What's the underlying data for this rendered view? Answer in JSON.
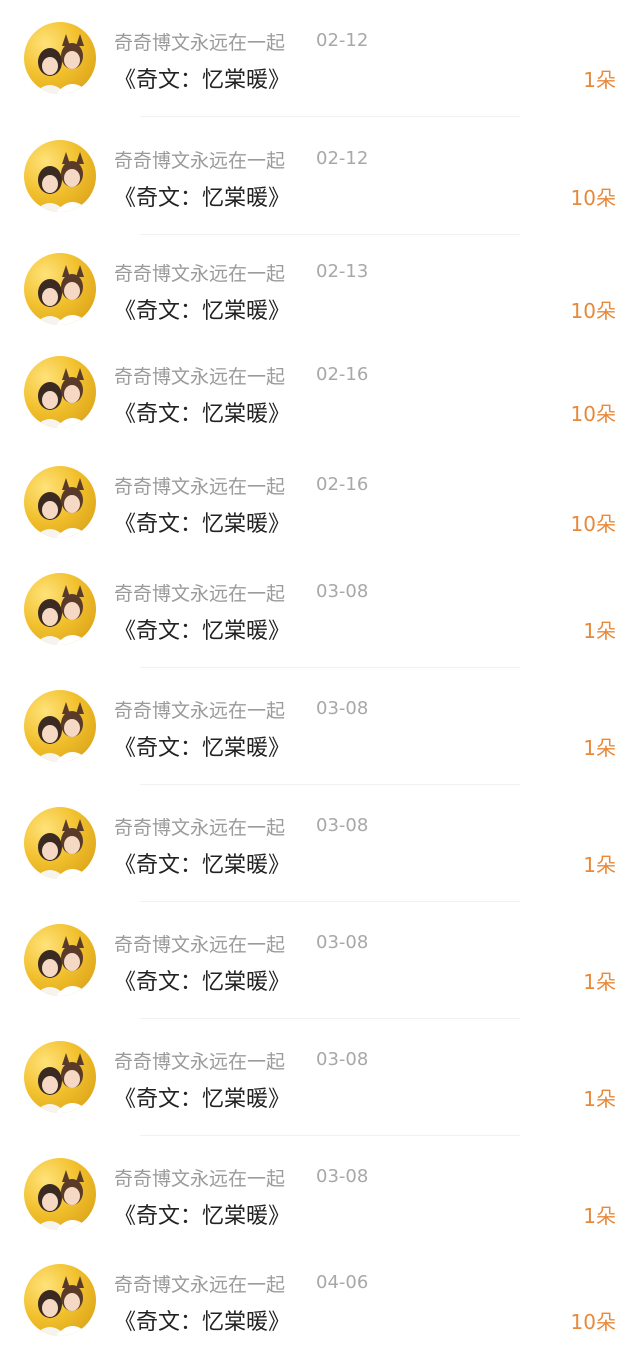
{
  "gift_list": {
    "items": [
      {
        "user": "奇奇博文永远在一起",
        "date": "02-12",
        "work_title": "《奇文：忆棠暖》",
        "gift_count": "1朵"
      },
      {
        "user": "奇奇博文永远在一起",
        "date": "02-12",
        "work_title": "《奇文：忆棠暖》",
        "gift_count": "10朵"
      },
      {
        "user": "奇奇博文永远在一起",
        "date": "02-13",
        "work_title": "《奇文：忆棠暖》",
        "gift_count": "10朵"
      },
      {
        "user": "奇奇博文永远在一起",
        "date": "02-16",
        "work_title": "《奇文：忆棠暖》",
        "gift_count": "10朵"
      },
      {
        "user": "奇奇博文永远在一起",
        "date": "02-16",
        "work_title": "《奇文：忆棠暖》",
        "gift_count": "10朵"
      },
      {
        "user": "奇奇博文永远在一起",
        "date": "03-08",
        "work_title": "《奇文：忆棠暖》",
        "gift_count": "1朵"
      },
      {
        "user": "奇奇博文永远在一起",
        "date": "03-08",
        "work_title": "《奇文：忆棠暖》",
        "gift_count": "1朵"
      },
      {
        "user": "奇奇博文永远在一起",
        "date": "03-08",
        "work_title": "《奇文：忆棠暖》",
        "gift_count": "1朵"
      },
      {
        "user": "奇奇博文永远在一起",
        "date": "03-08",
        "work_title": "《奇文：忆棠暖》",
        "gift_count": "1朵"
      },
      {
        "user": "奇奇博文永远在一起",
        "date": "03-08",
        "work_title": "《奇文：忆棠暖》",
        "gift_count": "1朵"
      },
      {
        "user": "奇奇博文永远在一起",
        "date": "03-08",
        "work_title": "《奇文：忆棠暖》",
        "gift_count": "1朵"
      },
      {
        "user": "奇奇博文永远在一起",
        "date": "04-06",
        "work_title": "《奇文：忆棠暖》",
        "gift_count": "10朵"
      }
    ]
  },
  "colors": {
    "accent": "#e8893a",
    "meta_text": "#9b9b9b",
    "title_text": "#222222",
    "avatar_bg": "#f2c12e"
  },
  "icons": {
    "avatar": "user-avatar-photo"
  }
}
